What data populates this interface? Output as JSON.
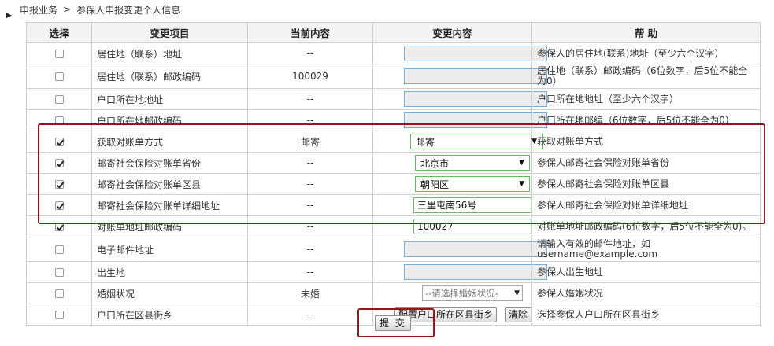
{
  "breadcrumb": {
    "part1": "申报业务",
    "separator": ">",
    "part2": "参保人申报变更个人信息"
  },
  "table": {
    "headers": {
      "select": "选择",
      "item": "变更项目",
      "current": "当前内容",
      "change": "变更内容",
      "help": "帮 助"
    },
    "rows": [
      {
        "checked": false,
        "item": "居住地（联系）地址",
        "current": "--",
        "change": "",
        "help": "参保人的居住地(联系)地址（至少六个汉字）"
      },
      {
        "checked": false,
        "item": "居住地（联系）邮政编码",
        "current": "100029",
        "change": "",
        "help": "居住地（联系）邮政编码（6位数字，后5位不能全为0）"
      },
      {
        "checked": false,
        "item": "户口所在地地址",
        "current": "--",
        "change": "",
        "help": "户口所在地地址（至少六个汉字）"
      },
      {
        "checked": false,
        "item": "户口所在地邮政编码",
        "current": "--",
        "change": "",
        "help": "户口所在地邮编（6位数字，后5位不能全为0）"
      },
      {
        "checked": true,
        "item": "获取对账单方式",
        "current": "邮寄",
        "change": "邮寄",
        "help": "获取对账单方式"
      },
      {
        "checked": true,
        "item": "邮寄社会保险对账单省份",
        "current": "--",
        "change": "北京市",
        "help": "参保人邮寄社会保险对账单省份"
      },
      {
        "checked": true,
        "item": "邮寄社会保险对账单区县",
        "current": "--",
        "change": "朝阳区",
        "help": "参保人邮寄社会保险对账单区县"
      },
      {
        "checked": true,
        "item": "邮寄社会保险对账单详细地址",
        "current": "--",
        "change": "三里屯南56号",
        "help": "参保人邮寄社会保险对账单详细地址"
      },
      {
        "checked": true,
        "item": "对账单地址邮政编码",
        "current": "--",
        "change": "100027",
        "help": "对账单地址邮政编码(6位数字，后5位不能全为0)。"
      },
      {
        "checked": false,
        "item": "电子邮件地址",
        "current": "--",
        "change": "",
        "help": "请输入有效的邮件地址，如username@example.com"
      },
      {
        "checked": false,
        "item": "出生地",
        "current": "--",
        "change": "",
        "help": "参保人出生地址"
      },
      {
        "checked": false,
        "item": "婚姻状况",
        "current": "未婚",
        "change": "--请选择婚姻状况-",
        "help": "参保人婚姻状况"
      },
      {
        "checked": false,
        "item": "户口所在区县街乡",
        "current": "--",
        "config_button": "配置户口所在区县街乡",
        "clear_button": "清除",
        "help": "选择参保人户口所在区县街乡"
      }
    ]
  },
  "submit_label": "提 交",
  "colors": {
    "highlight_border": "#8b1a1a",
    "header_bg": "#f3f3f3",
    "input_border_blue": "#7aaed8",
    "input_border_green": "#5fbf5f"
  }
}
